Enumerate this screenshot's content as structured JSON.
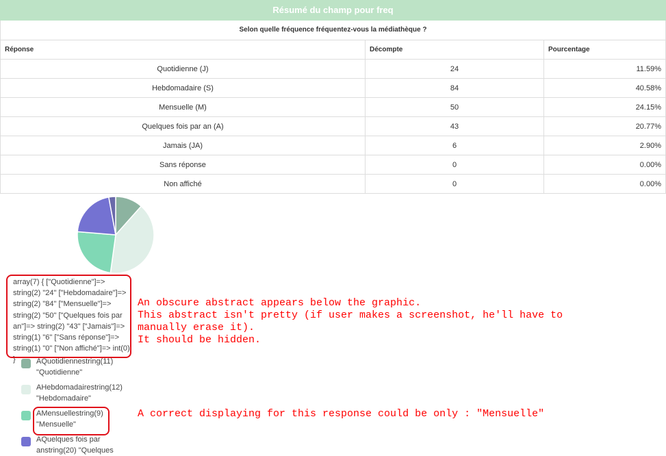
{
  "header": {
    "title": "Résumé du champ pour freq"
  },
  "question": "Selon quelle fréquence fréquentez-vous la médiathèque ?",
  "table": {
    "headers": [
      "Réponse",
      "Décompte",
      "Pourcentage"
    ],
    "rows": [
      [
        "Quotidienne (J)",
        "24",
        "11.59%"
      ],
      [
        "Hebdomadaire (S)",
        "84",
        "40.58%"
      ],
      [
        "Mensuelle (M)",
        "50",
        "24.15%"
      ],
      [
        "Quelques fois par an (A)",
        "43",
        "20.77%"
      ],
      [
        "Jamais (JA)",
        "6",
        "2.90%"
      ],
      [
        "Sans réponse",
        "0",
        "0.00%"
      ],
      [
        "Non affiché",
        "0",
        "0.00%"
      ]
    ]
  },
  "chart_data": {
    "type": "pie",
    "categories": [
      "Quotidienne",
      "Hebdomadaire",
      "Mensuelle",
      "Quelques fois par an",
      "Jamais"
    ],
    "values": [
      11.59,
      40.58,
      24.15,
      20.77,
      2.9
    ],
    "colors": [
      "#8cb3a0",
      "#e0efe8",
      "#80d8b5",
      "#7472d2",
      "#6a6aaa"
    ]
  },
  "debug_dump": "array(7) { [\"Quotidienne\"]=> string(2) \"24\" [\"Hebdomadaire\"]=> string(2) \"84\" [\"Mensuelle\"]=> string(2) \"50\" [\"Quelques fois par an\"]=> string(2) \"43\" [\"Jamais\"]=> string(1) \"6\" [\"Sans réponse\"]=> string(1) \"0\" [\"Non affiché\"]=> int(0) }",
  "legend": [
    {
      "label": "AQuotidiennestring(11) \"Quotidienne\"",
      "color": "#8cb3a0"
    },
    {
      "label": "AHebdomadairestring(12) \"Hebdomadaire\"",
      "color": "#e0efe8"
    },
    {
      "label": "AMensuellestring(9) \"Mensuelle\"",
      "color": "#80d8b5"
    },
    {
      "label": "AQuelques fois par anstring(20) \"Quelques",
      "color": "#7472d2"
    }
  ],
  "annotations": {
    "note1": "An obscure abstract appears below the graphic.\nThis abstract isn't pretty (if user makes a screenshot, he'll have to\nmanually erase it).\nIt should be hidden.",
    "note2": "A correct displaying for this response could be only : \"Mensuelle\""
  }
}
